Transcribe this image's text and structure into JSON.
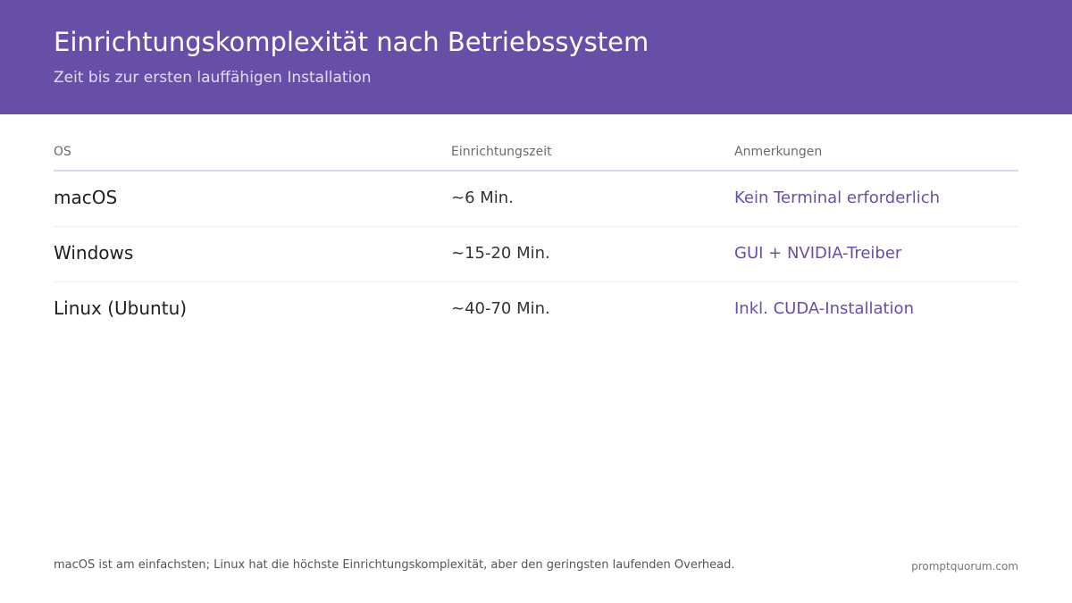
{
  "header": {
    "title": "Einrichtungskomplexität nach Betriebssystem",
    "subtitle": "Zeit bis zur ersten lauffähigen Installation",
    "background_color": "#674ea7"
  },
  "table": {
    "columns": [
      "OS",
      "Einrichtungszeit",
      "Anmerkungen"
    ],
    "rows": [
      {
        "os": "macOS",
        "time": "~6 Min.",
        "note": "Kein Terminal erforderlich"
      },
      {
        "os": "Windows",
        "time": "~15-20 Min.",
        "note": "GUI + NVIDIA-Treiber"
      },
      {
        "os": "Linux (Ubuntu)",
        "time": "~40-70 Min.",
        "note": "Inkl. CUDA-Installation"
      }
    ],
    "accent_color": "#674ea7"
  },
  "footer": {
    "note": "macOS ist am einfachsten; Linux hat die höchste Einrichtungskomplexität, aber den geringsten laufenden Overhead.",
    "site": "promptquorum.com"
  }
}
